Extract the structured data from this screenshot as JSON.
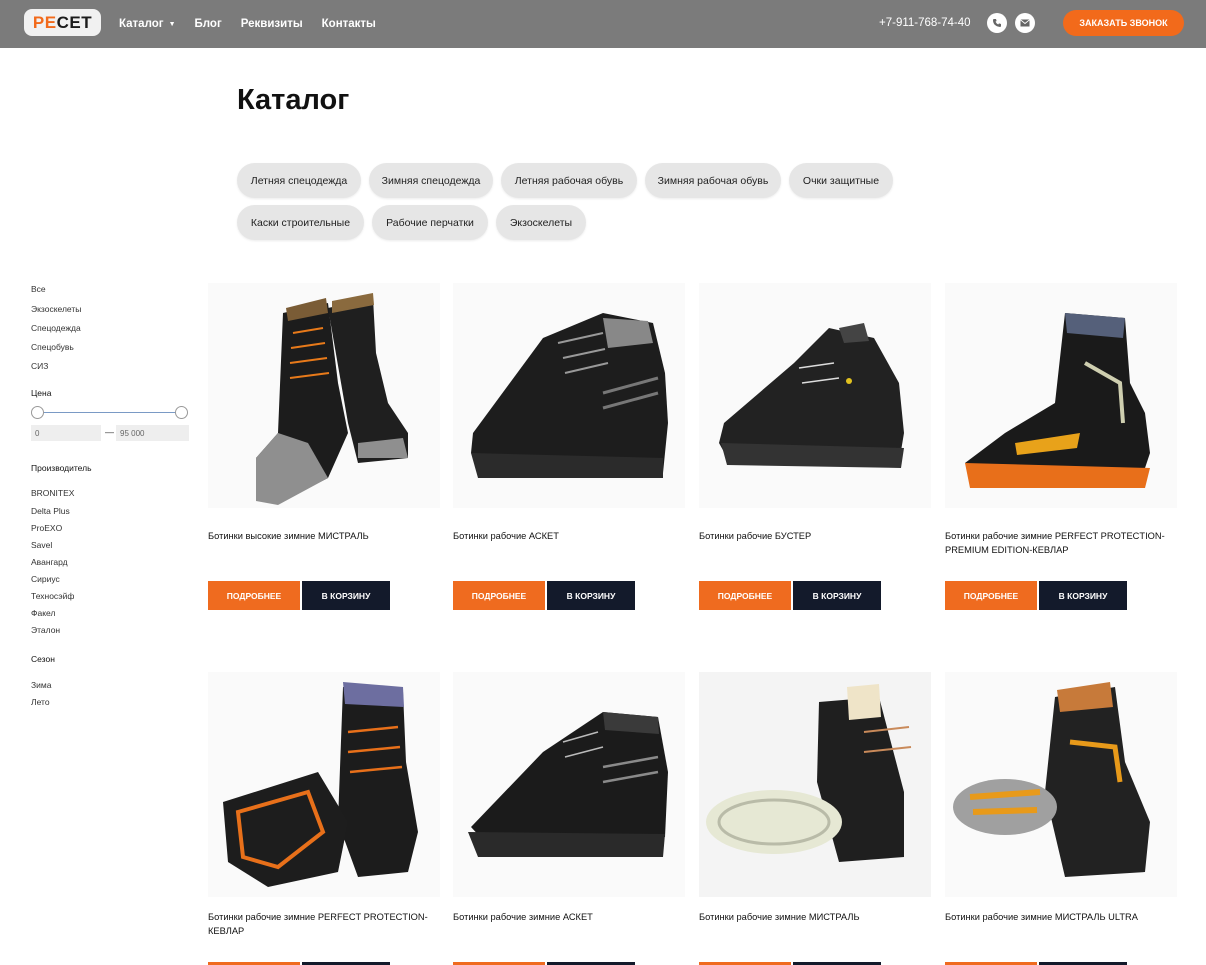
{
  "header": {
    "logo_pe": "PE",
    "logo_cet": "CET",
    "nav": [
      {
        "label": "Каталог",
        "has_dropdown": true
      },
      {
        "label": "Блог"
      },
      {
        "label": "Реквизиты"
      },
      {
        "label": "Контакты"
      }
    ],
    "phone": "+7-911-768-74-40",
    "icons": [
      "phone-icon",
      "mail-icon"
    ],
    "callback_label": "ЗАКАЗАТЬ ЗВОНОК",
    "accent_color": "#f26a1b"
  },
  "page_title": "Каталог",
  "categories": [
    "Летняя спецодежда",
    "Зимняя спецодежда",
    "Летняя рабочая обувь",
    "Зимняя рабочая обувь",
    "Очки защитные",
    "Каски строительные",
    "Рабочие перчатки",
    "Экзоскелеты"
  ],
  "sidebar": {
    "sections": [
      "Все",
      "Экзоскелеты",
      "Спецодежда",
      "Спецобувь",
      "СИЗ"
    ],
    "price": {
      "label": "Цена",
      "min": "0",
      "max": "95 000",
      "dash": "—"
    },
    "manufacturer": {
      "label": "Производитель",
      "items": [
        "BRONITEX",
        "Delta Plus",
        "ProEXO",
        "Savel",
        "Авангард",
        "Сириус",
        "Техносэйф",
        "Факел",
        "Эталон"
      ]
    },
    "season": {
      "label": "Сезон",
      "items": [
        "Зима",
        "Лето"
      ]
    }
  },
  "products": [
    {
      "name": "Ботинки высокие зимние МИСТРАЛЬ"
    },
    {
      "name": "Ботинки рабочие АСКЕТ"
    },
    {
      "name": "Ботинки рабочие БУСТЕР"
    },
    {
      "name": "Ботинки рабочие зимние PERFECT PROTECTION-PREMIUM EDITION-КЕВЛАР"
    },
    {
      "name": "Ботинки рабочие зимние PERFECT PROTECTION-КЕВЛАР"
    },
    {
      "name": "Ботинки рабочие зимние АСКЕТ"
    },
    {
      "name": "Ботинки рабочие зимние МИСТРАЛЬ"
    },
    {
      "name": "Ботинки рабочие зимние МИСТРАЛЬ ULTRA"
    }
  ],
  "buttons": {
    "more": "ПОДРОБНЕЕ",
    "cart": "В КОРЗИНУ"
  }
}
